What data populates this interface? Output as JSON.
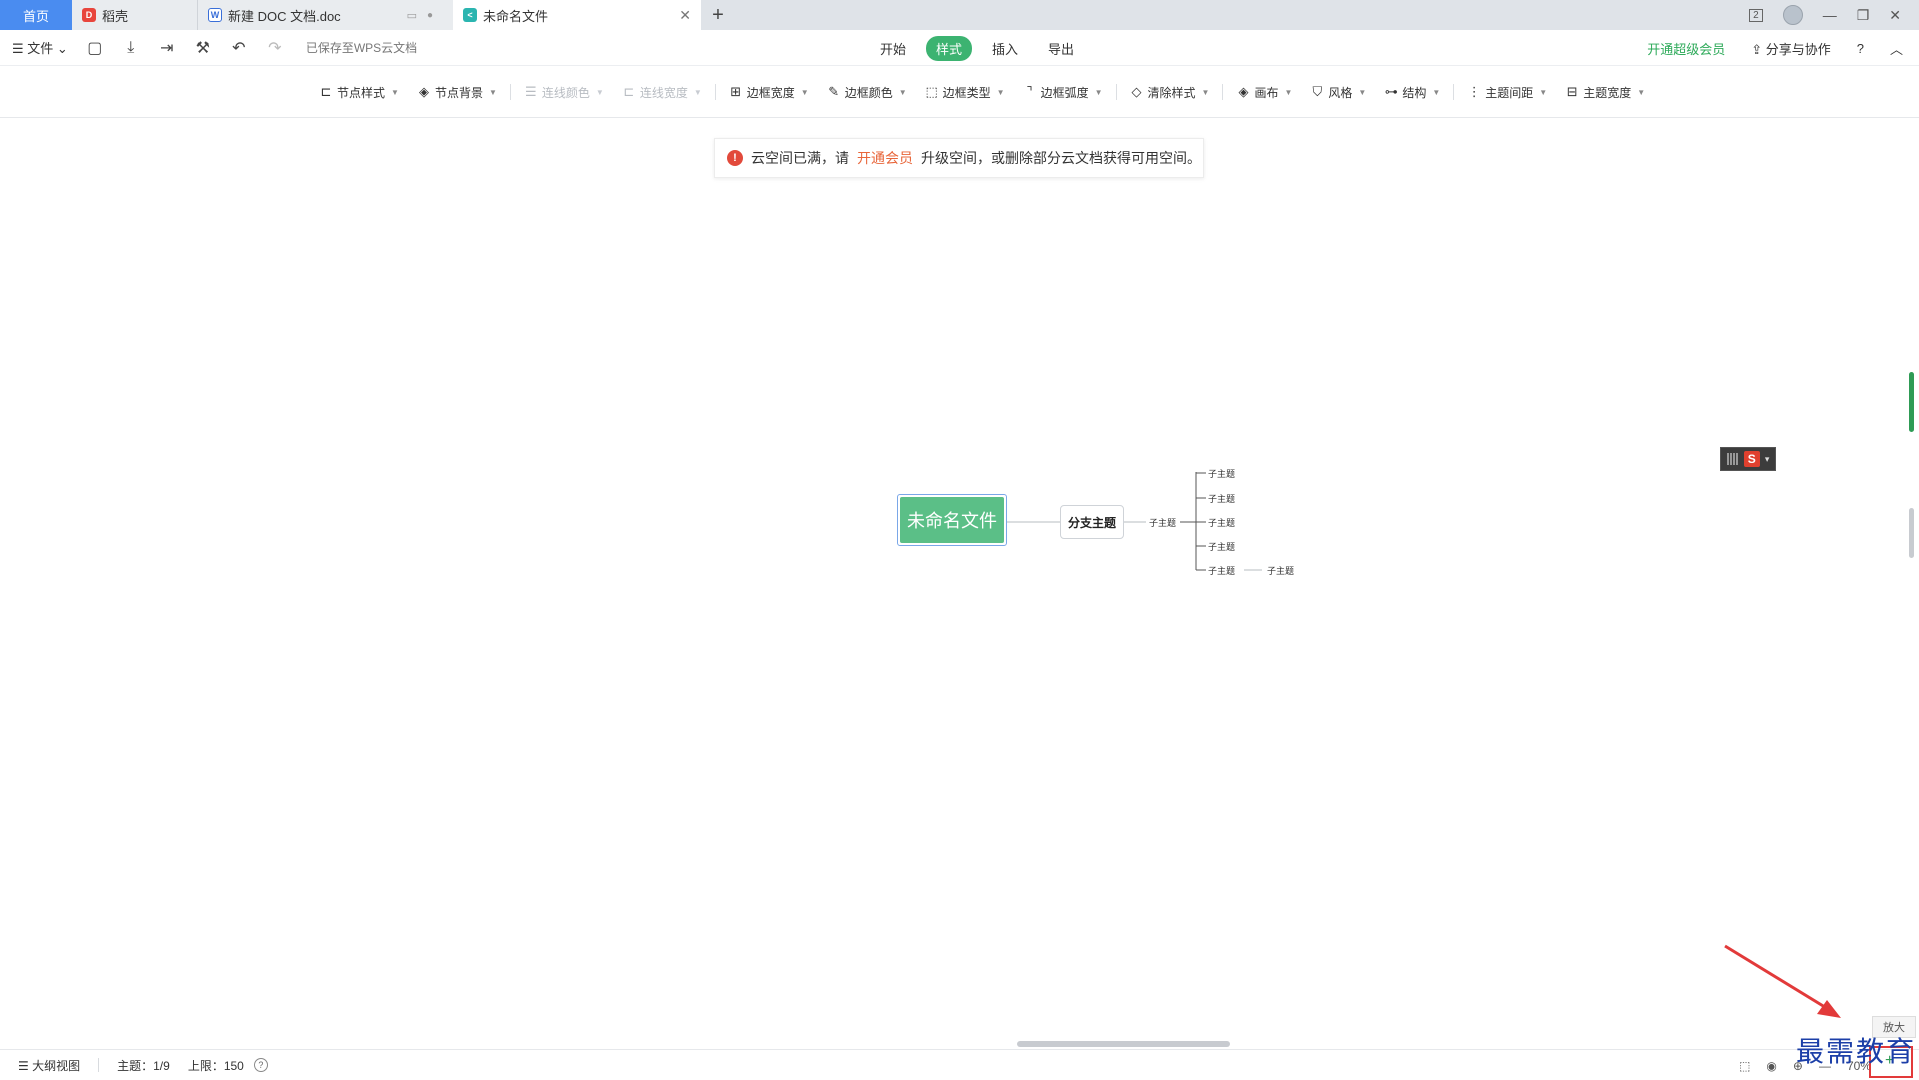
{
  "tabs": {
    "home": "首页",
    "tab2": "稻壳",
    "tab3": "新建 DOC 文档.doc",
    "tab4": "未命名文件",
    "new_tab": "+"
  },
  "window": {
    "badge": "2",
    "minimize": "—",
    "restore": "❐",
    "close": "✕"
  },
  "menu": {
    "file": "文件",
    "saved": "已保存至WPS云文档",
    "tabs": [
      "开始",
      "样式",
      "插入",
      "导出"
    ],
    "vip": "开通超级会员",
    "share": "分享与协作",
    "help": "?",
    "collapse": "︿"
  },
  "toolbar": {
    "items": [
      {
        "label": "节点样式"
      },
      {
        "label": "节点背景"
      },
      {
        "label": "连线颜色"
      },
      {
        "label": "连线宽度"
      },
      {
        "label": "边框宽度"
      },
      {
        "label": "边框颜色"
      },
      {
        "label": "边框类型"
      },
      {
        "label": "边框弧度"
      },
      {
        "label": "清除样式"
      },
      {
        "label": "画布"
      },
      {
        "label": "风格"
      },
      {
        "label": "结构"
      },
      {
        "label": "主题间距"
      },
      {
        "label": "主题宽度"
      }
    ]
  },
  "notice": {
    "prefix": "云空间已满，请",
    "link": "开通会员",
    "suffix": "升级空间，或删除部分云文档获得可用空间。"
  },
  "mindmap": {
    "root": "未命名文件",
    "branch": "分支主题",
    "sub_main": "子主题",
    "subs": [
      "子主题",
      "子主题",
      "子主题",
      "子主题",
      "子主题"
    ],
    "sub_child": "子主题"
  },
  "ime": {
    "logo": "S"
  },
  "status": {
    "outline": "大纲视图",
    "topics": "主题：1/9",
    "limit": "上限：150",
    "zoom": "70%",
    "zoom_tip": "放大",
    "zoom_out": "—",
    "zoom_in": "+"
  },
  "watermark": "最需教育"
}
